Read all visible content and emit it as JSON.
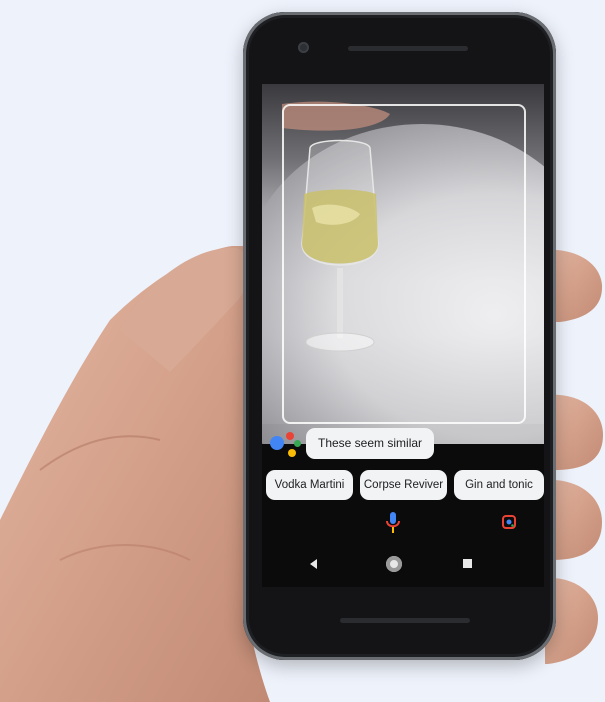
{
  "assistant": {
    "message": "These seem similar",
    "suggestions": [
      "Vodka Martini",
      "Corpse Reviver",
      "Gin and tonic"
    ]
  },
  "icons": {
    "assistant_logo": "google-assistant-dots-icon",
    "mic": "mic-icon",
    "lens": "lens-icon",
    "nav_back": "back-triangle-icon",
    "nav_home": "home-circle-icon",
    "nav_recent": "recent-apps-square-icon"
  },
  "colors": {
    "google_blue": "#4285f4",
    "google_red": "#ea4335",
    "google_yellow": "#fbbc05",
    "google_green": "#34a853",
    "chip_bg": "#f1f3f4"
  }
}
